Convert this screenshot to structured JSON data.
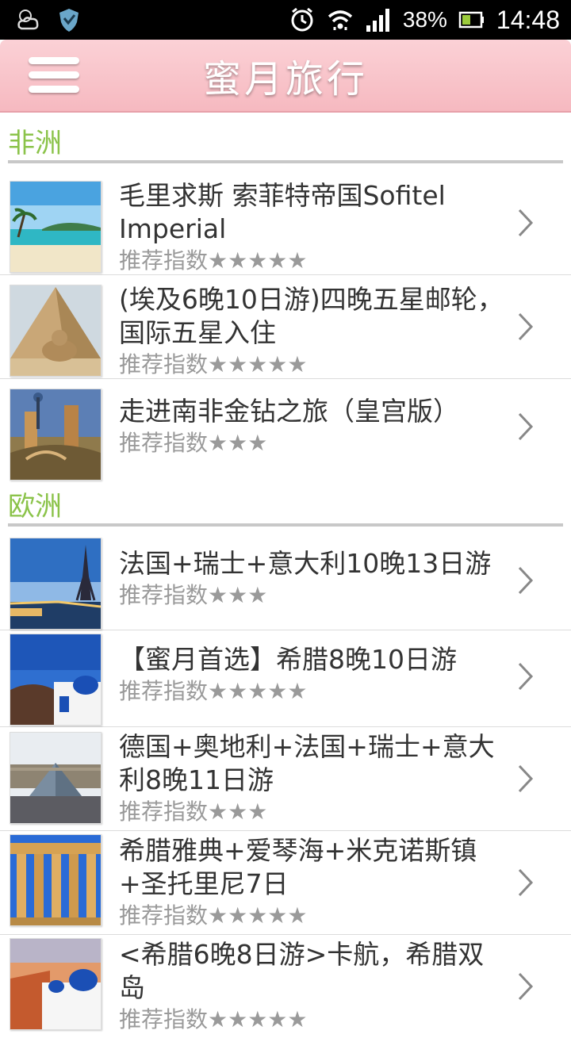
{
  "status_bar": {
    "battery": "38%",
    "time": "14:48"
  },
  "header": {
    "title": "蜜月旅行"
  },
  "sections": [
    {
      "title": "非洲",
      "items": [
        {
          "name": "毛里求斯 索菲特帝国Sofitel Imperial",
          "rating": "推荐指数★★★★★"
        },
        {
          "name": "(埃及6晚10日游)四晚五星邮轮，国际五星入住",
          "rating": "推荐指数★★★★★"
        },
        {
          "name": "走进南非金钻之旅（皇宫版）",
          "rating": "推荐指数★★★"
        }
      ]
    },
    {
      "title": "欧洲",
      "items": [
        {
          "name": "法国+瑞士+意大利10晚13日游",
          "rating": "推荐指数★★★"
        },
        {
          "name": "【蜜月首选】希腊8晚10日游",
          "rating": "推荐指数★★★★★"
        },
        {
          "name": "德国+奥地利+法国+瑞士+意大利8晚11日游",
          "rating": "推荐指数★★★"
        },
        {
          "name": "希腊雅典+爱琴海+米克诺斯镇+圣托里尼7日",
          "rating": "推荐指数★★★★★"
        },
        {
          "name": "<希腊6晚8日游>卡航，希腊双岛",
          "rating": "推荐指数★★★★★"
        }
      ]
    }
  ]
}
